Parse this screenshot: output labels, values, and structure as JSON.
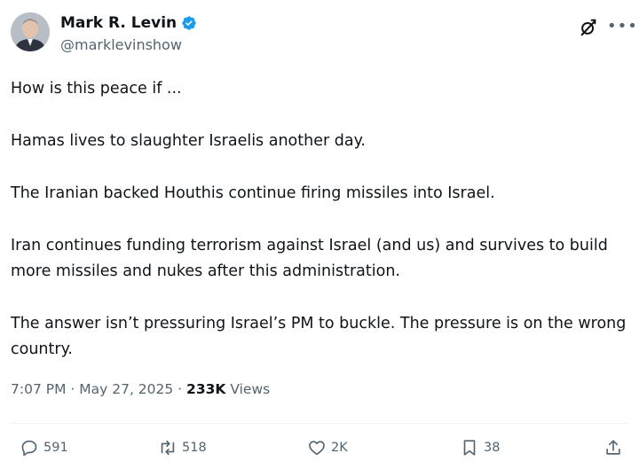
{
  "author": {
    "name": "Mark R. Levin",
    "handle": "@marklevinshow"
  },
  "icons": {
    "verified": "verified-badge-icon",
    "grok": "grok-icon",
    "more": "more-options-icon",
    "reply": "reply-icon",
    "repost": "repost-icon",
    "like": "heart-icon",
    "bookmark": "bookmark-icon",
    "share": "share-icon"
  },
  "colors": {
    "verified_blue": "#1d9bf0",
    "text_primary": "#0f1419",
    "text_secondary": "#536471"
  },
  "body": {
    "paragraphs": [
      "How is this peace if ...",
      "Hamas lives to slaughter Israelis another day.",
      "The Iranian backed Houthis continue firing missiles into Israel.",
      "Iran continues funding terrorism against Israel (and us) and survives to build more missiles and nukes after this administration.",
      "The answer isn’t pressuring Israel’s PM to buckle. The pressure is on the wrong country."
    ]
  },
  "meta": {
    "time": "7:07 PM",
    "date": "May 27, 2025",
    "separator": " · ",
    "views_count": "233K",
    "views_label": "Views"
  },
  "actions": {
    "replies": "591",
    "reposts": "518",
    "likes": "2K",
    "bookmarks": "38"
  }
}
